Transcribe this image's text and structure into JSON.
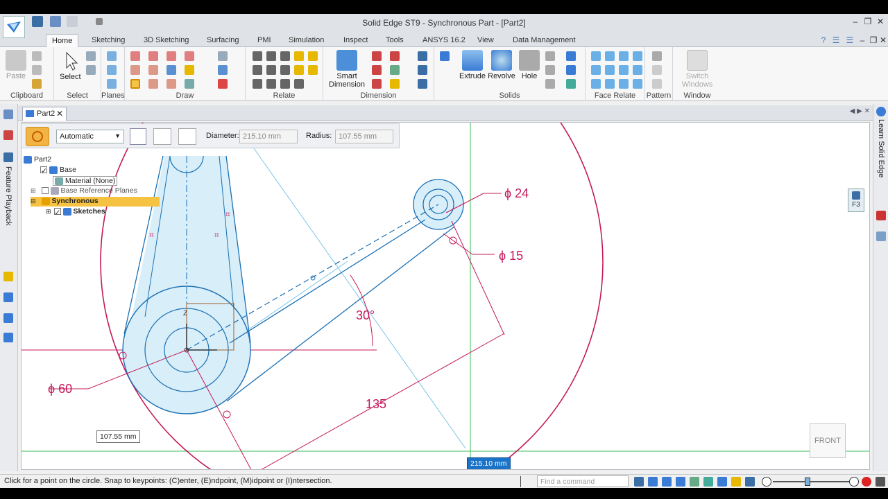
{
  "window": {
    "title": "Solid Edge ST9 - Synchronous Part - [Part2]"
  },
  "ribbon_tabs": [
    {
      "label": "Home"
    },
    {
      "label": "Sketching"
    },
    {
      "label": "3D Sketching"
    },
    {
      "label": "Surfacing"
    },
    {
      "label": "PMI"
    },
    {
      "label": "Simulation"
    },
    {
      "label": "Inspect"
    },
    {
      "label": "Tools"
    },
    {
      "label": "ANSYS 16.2"
    },
    {
      "label": "View"
    },
    {
      "label": "Data Management"
    }
  ],
  "ribbon": {
    "groups": {
      "clipboard": "Clipboard",
      "select": "Select",
      "planes": "Planes",
      "draw": "Draw",
      "relate": "Relate",
      "dimension": "Dimension",
      "solids": "Solids",
      "face_relate": "Face Relate",
      "pattern": "Pattern",
      "window": "Window"
    },
    "buttons": {
      "paste": "Paste",
      "select": "Select",
      "smart_dimension_1": "Smart",
      "smart_dimension_2": "Dimension",
      "extrude": "Extrude",
      "revolve": "Revolve",
      "hole": "Hole",
      "switch_windows_1": "Switch",
      "switch_windows_2": "Windows"
    }
  },
  "document_tab": {
    "label": "Part2"
  },
  "command_bar": {
    "mode": "Automatic",
    "diameter_label": "Diameter:",
    "diameter_value": "215.10 mm",
    "radius_label": "Radius:",
    "radius_value": "107.55 mm"
  },
  "tree": {
    "root": "Part2",
    "base": "Base",
    "material": "Material (None)",
    "ref_planes": "Base Reference Planes",
    "synchronous": "Synchronous",
    "sketches": "Sketches"
  },
  "side_panels": {
    "left": "Feature Playback",
    "right": "Learn Solid Edge"
  },
  "canvas": {
    "dims": {
      "phi24": "ϕ 24",
      "phi15": "ϕ 15",
      "phi60": "ϕ 60",
      "angle": "30°",
      "length": "135"
    },
    "input_radius": "107.55 mm",
    "input_diameter": "215.10 mm",
    "view_cube": "FRONT",
    "lock_key": "F3",
    "axis_label": "Z"
  },
  "status": {
    "prompt": "Click for a point on the circle.  Snap to keypoints: (C)enter, (E)ndpoint, (M)idpoint or (I)ntersection.",
    "find_placeholder": "Find a command"
  },
  "colors": {
    "sketch_blue": "#1a6fb3",
    "dim_magenta": "#c4185a",
    "fill_blue": "#d8eef8",
    "axis_green": "#3dbb5a"
  }
}
